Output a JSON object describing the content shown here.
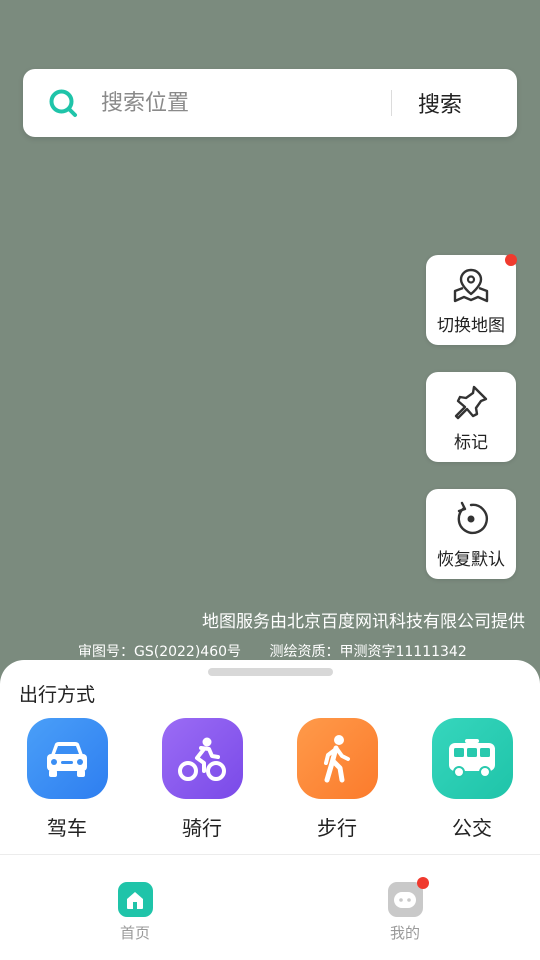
{
  "search": {
    "placeholder": "搜索位置",
    "button_label": "搜索"
  },
  "map_controls": [
    {
      "label": "切换地图",
      "icon": "map-pin-icon",
      "badge": true
    },
    {
      "label": "标记",
      "icon": "pushpin-icon",
      "badge": false
    },
    {
      "label": "恢复默认",
      "icon": "reset-icon",
      "badge": false
    }
  ],
  "attribution": {
    "provider": "地图服务由北京百度网讯科技有限公司提供",
    "approval_no": "审图号：GS(2022)460号",
    "survey_qualification": "测绘资质：甲测资字11111342"
  },
  "travel": {
    "title": "出行方式",
    "modes": [
      {
        "label": "驾车",
        "icon": "car-icon",
        "color_from": "#4a9ff8",
        "color_to": "#2e7ef0"
      },
      {
        "label": "骑行",
        "icon": "bicycle-icon",
        "color_from": "#9b6cf5",
        "color_to": "#7a4ae8"
      },
      {
        "label": "步行",
        "icon": "walking-icon",
        "color_from": "#ff9a4a",
        "color_to": "#fb7b2c"
      },
      {
        "label": "公交",
        "icon": "bus-icon",
        "color_from": "#36d6bd",
        "color_to": "#1fc4a9"
      }
    ]
  },
  "nav": {
    "home_label": "首页",
    "mine_label": "我的",
    "home_icon": "home-icon",
    "mine_icon": "profile-icon",
    "mine_badge": true,
    "accent": "#1fc4a9",
    "badge_color": "#f03a2e"
  }
}
